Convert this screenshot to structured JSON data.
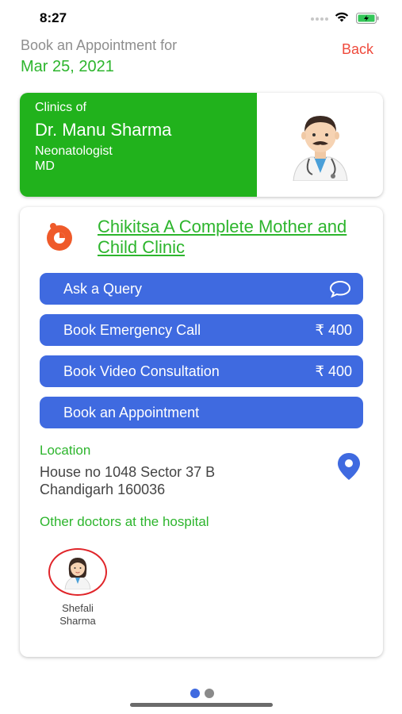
{
  "status_bar": {
    "time": "8:27"
  },
  "header": {
    "book_for_label": "Book an Appointment for",
    "date": "Mar 25, 2021",
    "back_label": "Back"
  },
  "doctor": {
    "clinics_of_label": "Clinics of",
    "name": "Dr. Manu Sharma",
    "specialty": "Neonatologist",
    "degree": "MD",
    "avatar_icon": "doctor-man-icon"
  },
  "clinic": {
    "name": "Chikitsa A Complete Mother and Child Clinic",
    "logo_icon": "clinic-logo-icon",
    "buttons": {
      "ask_query": "Ask a Query",
      "emergency": "Book Emergency Call",
      "emergency_price": "₹ 400",
      "video": "Book Video Consultation",
      "video_price": "₹ 400",
      "appointment": "Book an Appointment"
    },
    "location_label": "Location",
    "address_line1": "House no 1048 Sector 37 B",
    "address_line2": "Chandigarh 160036",
    "other_doctors_label": "Other doctors at the hospital",
    "other_doctors": [
      {
        "name_line1": "Shefali",
        "name_line2": "Sharma"
      }
    ]
  },
  "colors": {
    "green": "#21b21c",
    "blue": "#3f6ae0",
    "red": "#ef4a3c"
  }
}
